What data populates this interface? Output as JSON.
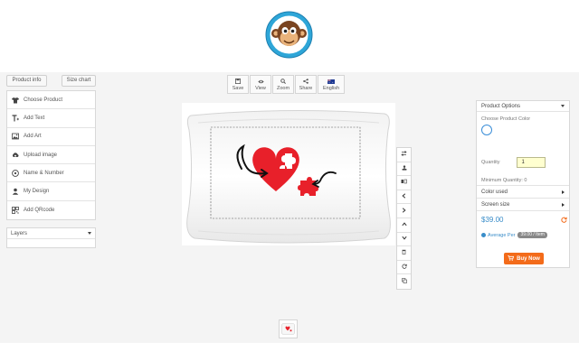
{
  "top_buttons": {
    "product_info": "Product info",
    "size_chart": "Size chart"
  },
  "left_menu": [
    {
      "label": "Choose Product",
      "icon": "shirt-icon"
    },
    {
      "label": "Add Text",
      "icon": "text-icon"
    },
    {
      "label": "Add Art",
      "icon": "image-icon"
    },
    {
      "label": "Upload image",
      "icon": "upload-icon"
    },
    {
      "label": "Name & Number",
      "icon": "ball-icon"
    },
    {
      "label": "My Design",
      "icon": "user-icon"
    },
    {
      "label": "Add QRcode",
      "icon": "qrcode-icon"
    }
  ],
  "layers": {
    "label": "Layers"
  },
  "toolbar": [
    {
      "label": "Save",
      "icon": "save-icon"
    },
    {
      "label": "View",
      "icon": "eye-icon"
    },
    {
      "label": "Zoom",
      "icon": "search-icon"
    },
    {
      "label": "Share",
      "icon": "share-icon"
    },
    {
      "label": "English",
      "icon": "flag-icon"
    }
  ],
  "side_tools": [
    "swap-icon",
    "stamp-icon",
    "flip-icon",
    "arrow-left-icon",
    "arrow-right-icon",
    "arrow-up-icon",
    "arrow-down-icon",
    "trash-icon",
    "reset-icon",
    "copy-icon"
  ],
  "product_options": {
    "title": "Product Options",
    "choose_color_label": "Choose Product Color",
    "color": "#ffffff",
    "quantity_label": "Quantity",
    "quantity_value": "1",
    "min_quantity": "Minimum Quantity: 0",
    "color_used": "Color used",
    "screen_size": "Screen size",
    "price": "$39.00",
    "avg_label": "Average Per",
    "avg_badge": "39.00 / Item",
    "buy_now": "Buy Now"
  },
  "colors": {
    "accent": "#3a8dc9",
    "buy": "#f36b1a",
    "heart": "#e8202a"
  }
}
